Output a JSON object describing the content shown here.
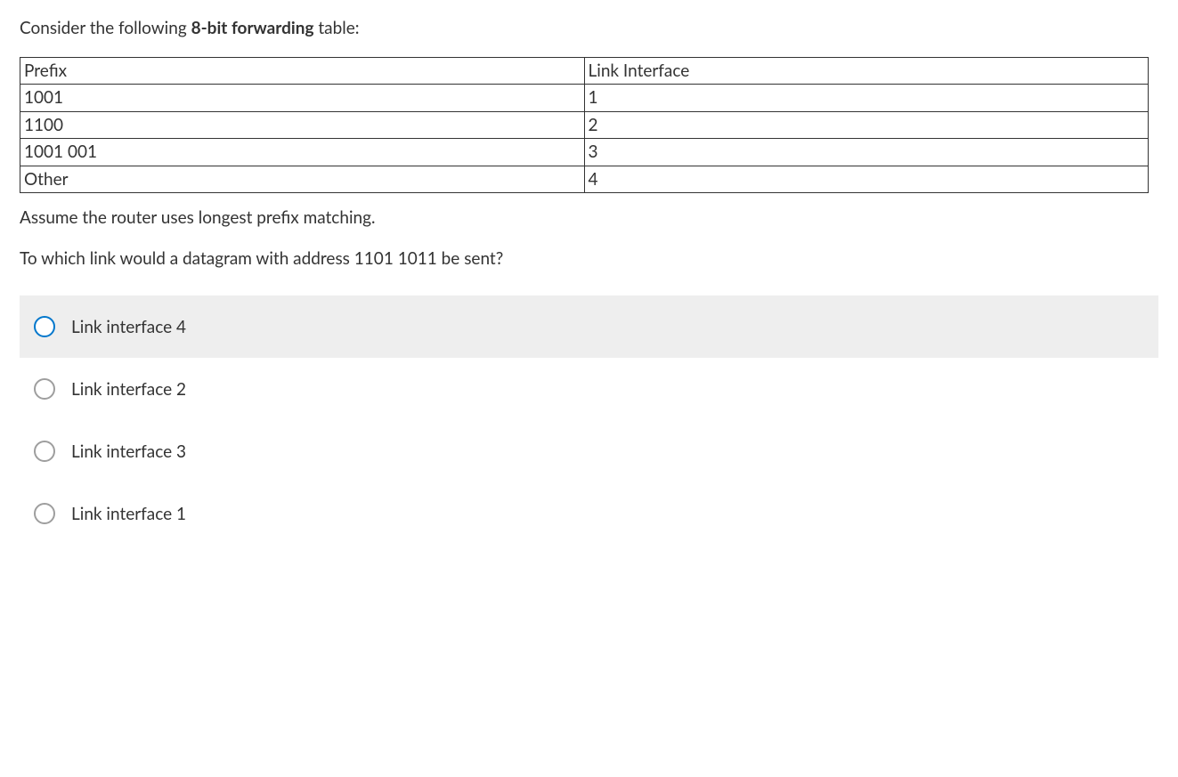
{
  "question": {
    "intro_pre": "Consider the following ",
    "intro_bold": "8-bit forwarding",
    "intro_post": " table:",
    "table": {
      "header": {
        "c1": "Prefix",
        "c2": "Link Interface"
      },
      "rows": [
        {
          "c1": "1001",
          "c2": "1"
        },
        {
          "c1": "1100",
          "c2": "2"
        },
        {
          "c1": "1001 001",
          "c2": "3"
        },
        {
          "c1": "Other",
          "c2": "4"
        }
      ]
    },
    "line2": "Assume the router uses longest prefix matching.",
    "line3": "To which link would a datagram with address 1101 1011 be sent?"
  },
  "answers": [
    {
      "label": "Link interface 4",
      "selected": true
    },
    {
      "label": "Link interface 2",
      "selected": false
    },
    {
      "label": "Link interface 3",
      "selected": false
    },
    {
      "label": "Link interface 1",
      "selected": false
    }
  ]
}
